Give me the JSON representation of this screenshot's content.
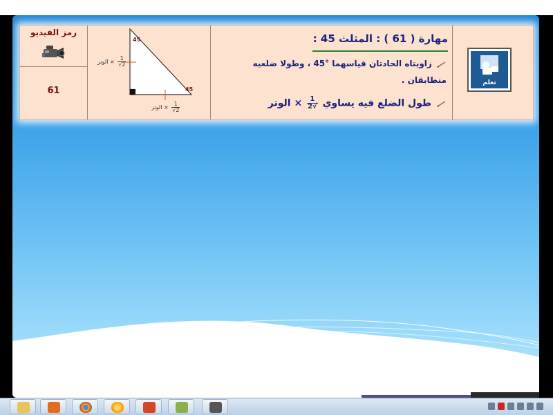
{
  "video_cell": {
    "title": "رمز الفيديو",
    "number": "61",
    "camera_icon": "video-camera-icon"
  },
  "skill": {
    "title": "مهارة ( 61 ) : المثلث 45     :",
    "line1": "زاويتاه الحادتان قياسهما °45 ، وطولا ضلعيه",
    "line2": "متطابقان .",
    "line3_before": "طول الضلع فيه يساوي",
    "line3_after": "× الوتر",
    "frac_num": "1",
    "frac_den": "√2",
    "bullet_icon": "pencil-icon"
  },
  "triangle": {
    "angle_top": "45",
    "angle_right": "45",
    "leg_label": "الوتر",
    "times": "×",
    "frac_num": "1",
    "frac_den": "√2"
  },
  "logo": {
    "label": "تعلم",
    "icon": "learner-reading-icon"
  },
  "taskbar": {
    "apps": [
      "file-explorer-icon",
      "media-player-icon",
      "chrome-icon",
      "firefox-icon",
      "powerpoint-icon",
      "green-app-icon",
      "video-recorder-icon"
    ]
  },
  "colors": {
    "card_bg": "#fde3cf",
    "title_blue": "#1a237e",
    "dark_red": "#7a1414",
    "slide_blue": "#3ea3ea"
  }
}
